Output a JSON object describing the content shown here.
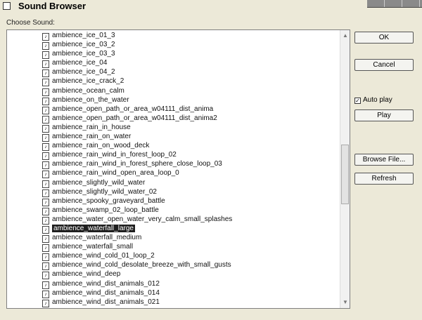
{
  "window": {
    "title": "Sound Browser"
  },
  "label": "Choose Sound:",
  "sounds": [
    "ambience_ice_01_3",
    "ambience_ice_03_2",
    "ambience_ice_03_3",
    "ambience_ice_04",
    "ambience_ice_04_2",
    "ambience_ice_crack_2",
    "ambience_ocean_calm",
    "ambience_on_the_water",
    "ambience_open_path_or_area_w04111_dist_anima",
    "ambience_open_path_or_area_w04111_dist_anima2",
    "ambience_rain_in_house",
    "ambience_rain_on_water",
    "ambience_rain_on_wood_deck",
    "ambience_rain_wind_in_forest_loop_02",
    "ambience_rain_wind_in_forest_sphere_close_loop_03",
    "ambience_rain_wind_open_area_loop_0",
    "ambience_slightly_wild_water",
    "ambience_slightly_wild_water_02",
    "ambience_spooky_graveyard_battle",
    "ambience_swamp_02_loop_battle",
    "ambience_water_open_water_very_calm_small_splashes",
    "ambience_waterfall_large",
    "ambience_waterfall_medium",
    "ambience_waterfall_small",
    "ambience_wind_cold_01_loop_2",
    "ambience_wind_cold_desolate_breeze_with_small_gusts",
    "ambience_wind_deep",
    "ambience_wind_dist_animals_012",
    "ambience_wind_dist_animals_014",
    "ambience_wind_dist_animals_021"
  ],
  "selected_index": 21,
  "buttons": {
    "ok": "OK",
    "cancel": "Cancel",
    "play": "Play",
    "browse": "Browse File...",
    "refresh": "Refresh"
  },
  "autoplay": {
    "label": "Auto play",
    "checked": true
  }
}
